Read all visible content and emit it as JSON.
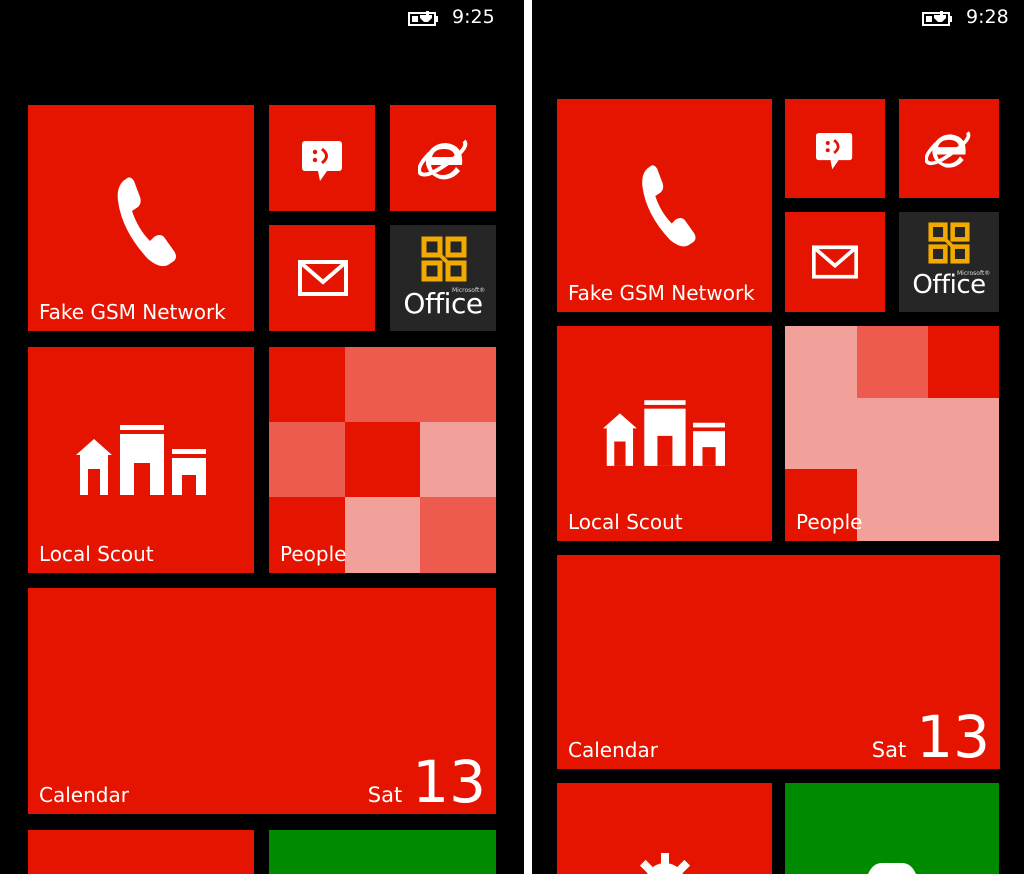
{
  "left": {
    "status": {
      "time": "9:25"
    },
    "tiles": {
      "phone_label": "Fake GSM Network",
      "scout_label": "Local Scout",
      "people_label": "People",
      "calendar": {
        "label": "Calendar",
        "day": "Sat",
        "date": "13"
      },
      "office": {
        "brand": "Office",
        "ms": "Microsoft®"
      }
    }
  },
  "right": {
    "status": {
      "time": "9:28"
    },
    "tiles": {
      "phone_label": "Fake GSM Network",
      "scout_label": "Local Scout",
      "people_label": "People",
      "calendar": {
        "label": "Calendar",
        "day": "Sat",
        "date": "13"
      },
      "office": {
        "brand": "Office",
        "ms": "Microsoft®"
      }
    }
  },
  "colors": {
    "accent": "#e51400",
    "background": "#000000",
    "office_tile": "#262626",
    "xbox_tile": "#008a00"
  }
}
